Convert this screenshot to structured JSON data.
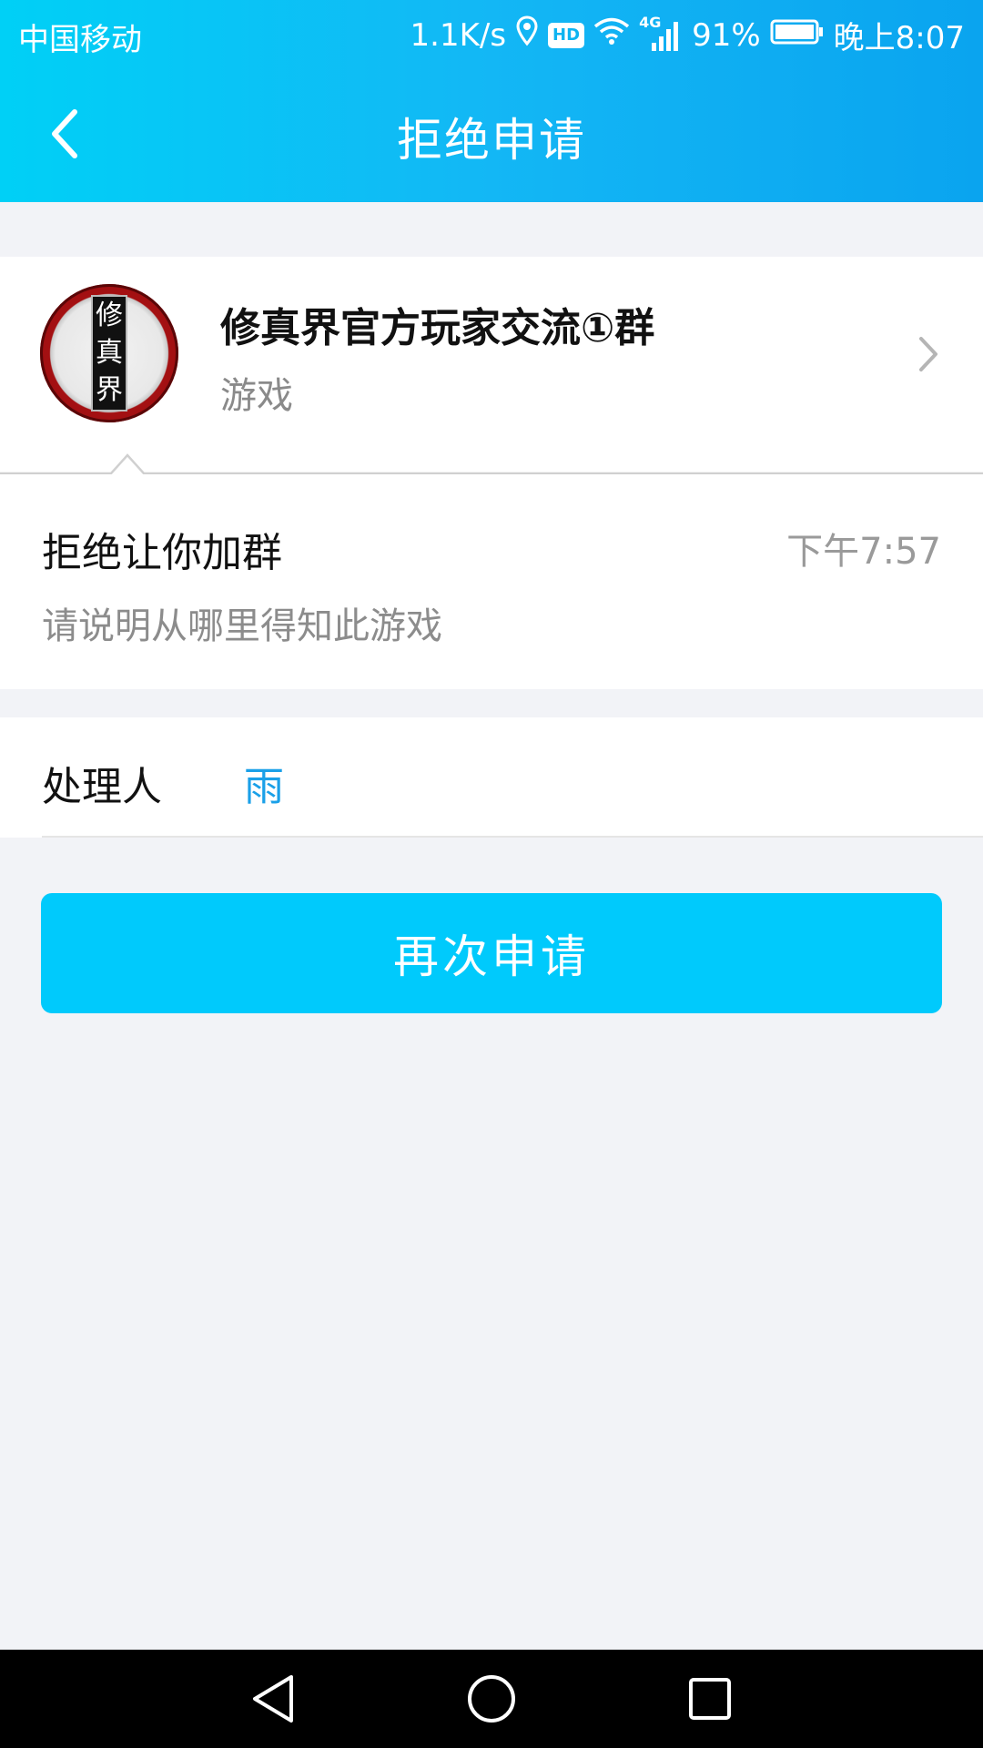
{
  "status_bar": {
    "carrier": "中国移动",
    "net_speed": "1.1K/s",
    "hd_label": "HD",
    "signal_type": "4G",
    "battery_percent": "91%",
    "time": "晚上8:07",
    "icons": [
      "location-icon",
      "hd-icon",
      "wifi-icon",
      "signal-icon",
      "battery-icon"
    ]
  },
  "title_bar": {
    "title": "拒绝申请",
    "back_icon": "back-arrow-icon"
  },
  "group": {
    "name": "修真界官方玩家交流①群",
    "category": "游戏",
    "avatar_text": [
      "修",
      "真",
      "界"
    ]
  },
  "rejection": {
    "title": "拒绝让你加群",
    "time": "下午7:57",
    "reason": "请说明从哪里得知此游戏"
  },
  "handler": {
    "label": "处理人",
    "value": "雨"
  },
  "actions": {
    "reapply_label": "再次申请"
  },
  "colors": {
    "header_start": "#00d0f6",
    "header_end": "#0aa4ef",
    "button": "#00cafc",
    "handler_link": "#1aa0e8",
    "background": "#f2f3f7"
  }
}
